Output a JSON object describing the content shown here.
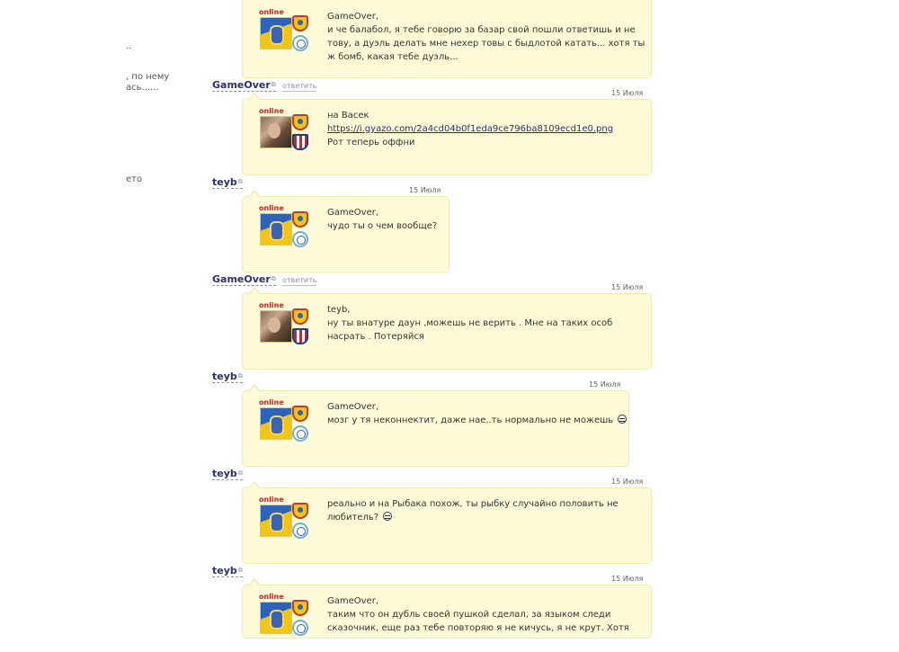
{
  "sidebar": {
    "fragments": [
      "..",
      ", по нему",
      "ась......",
      "ето"
    ]
  },
  "feed": {
    "reply_label": "ответить",
    "online_label": "online",
    "posts": [
      {
        "author": "",
        "date": "",
        "lines": [
          "GameOver,",
          "и че балабол, я тебе говорю за базар свой пошли ответишь и не",
          "тову, а дуэль делать мне нехер товы с быдлотой катать... хотя ты",
          "ж бомб, какая тебе дуэль..."
        ]
      },
      {
        "author": "GameOver",
        "date": "15 Июля",
        "lines": [
          "на Васек",
          "https://i.gyazo.com/2a4cd04b0f1eda9ce796ba8109ecd1e0.png",
          "Рот теперь оффни"
        ]
      },
      {
        "author": "teyb",
        "date": "15 Июля",
        "lines": [
          "GameOver,",
          "чудо ты о чем вообще?"
        ]
      },
      {
        "author": "GameOver",
        "date": "15 Июля",
        "lines": [
          "teyb,",
          "ну ты внатуре даун ,можешь не верить . Мне на таких особ",
          "насрать . Потеряйся"
        ]
      },
      {
        "author": "teyb",
        "date": "15 Июля",
        "lines": [
          "GameOver,",
          "мозг у тя неконнектит, даже нае..ть нормально не можешь"
        ]
      },
      {
        "author": "teyb",
        "date": "15 Июля",
        "lines": [
          "реально и на Рыбака похож, ты рыбку случайно половить не",
          "любитель?"
        ]
      },
      {
        "author": "teyb",
        "date": "15 Июля",
        "lines": [
          "GameOver,",
          "таким что он дубль своей пушкой сделал, за языком следи",
          "сказочник, еще раз тебе повторяю я не кичусь, я не крут. Хотя"
        ]
      }
    ]
  },
  "colors": {
    "bubble_bg": "#fffbd8",
    "bubble_border": "#ecebb4",
    "author": "#2b2f6b",
    "online": "#d02020"
  }
}
